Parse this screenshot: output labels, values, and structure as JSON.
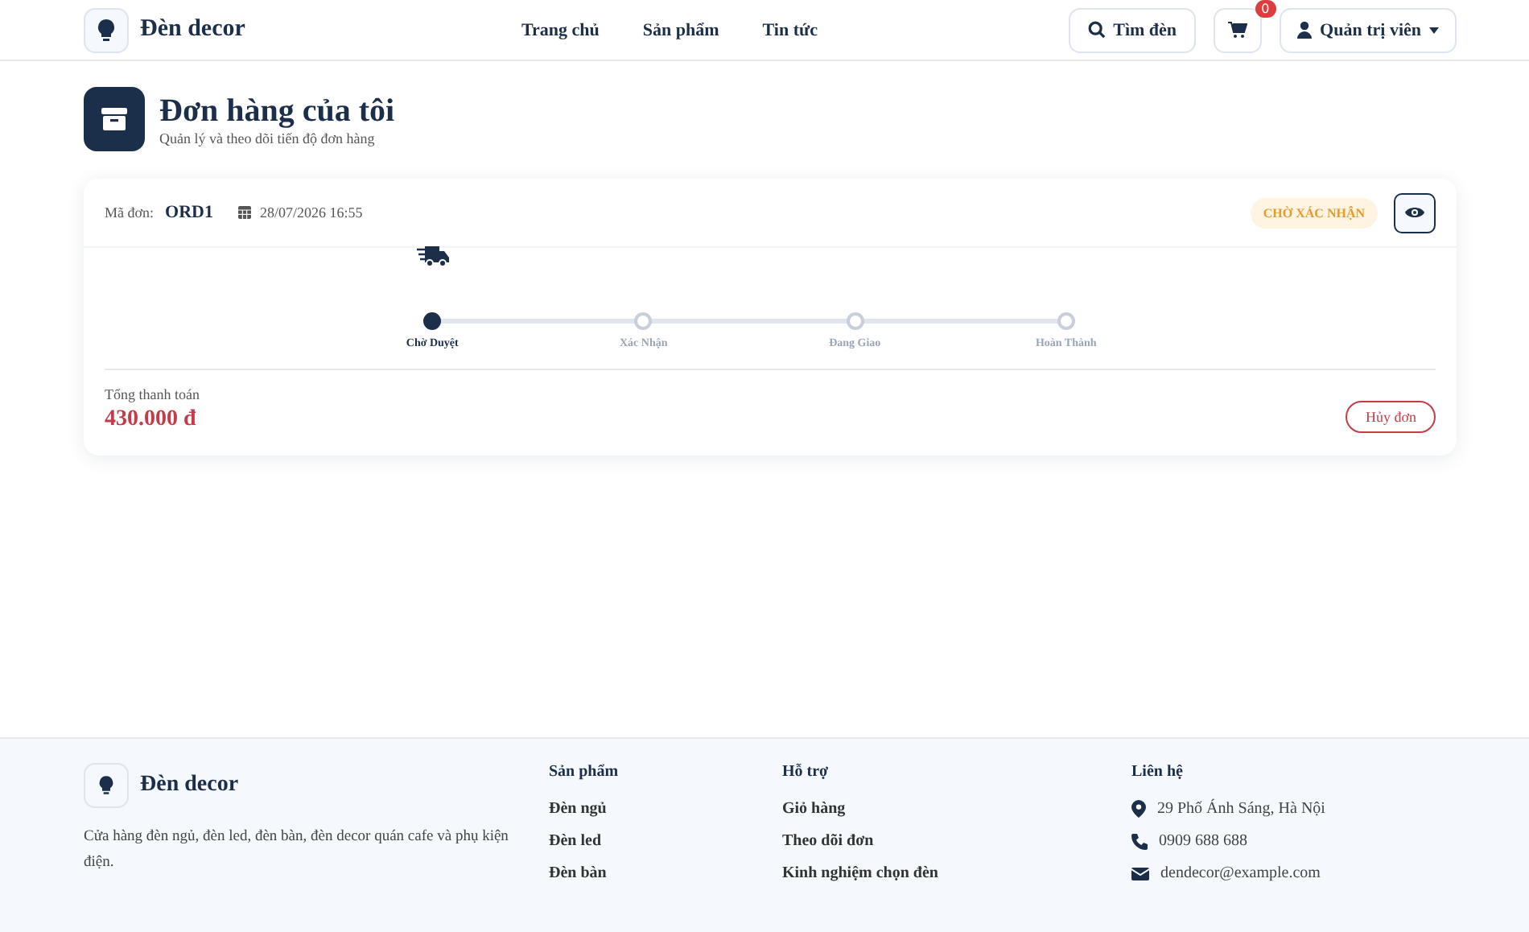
{
  "header": {
    "brand": "Đèn decor",
    "nav": [
      {
        "label": "Trang chủ"
      },
      {
        "label": "Sản phẩm"
      },
      {
        "label": "Tin tức"
      }
    ],
    "search_button": "Tìm đèn",
    "cart_count": "0",
    "user_menu": "Quản trị viên"
  },
  "page": {
    "title": "Đơn hàng của tôi",
    "subtitle": "Quản lý và theo dõi tiến độ đơn hàng"
  },
  "orders": [
    {
      "code_label": "Mã đơn:",
      "code": "ORD1",
      "date": "28/07/2026 16:55",
      "status": "CHỜ XÁC NHẬN",
      "steps": [
        {
          "label": "Chờ Duyệt",
          "selected": true
        },
        {
          "label": "Xác Nhận",
          "selected": false
        },
        {
          "label": "Đang Giao",
          "selected": false
        },
        {
          "label": "Hoàn Thành",
          "selected": false
        }
      ],
      "total_label": "Tổng thanh toán",
      "total": "430.000 đ",
      "cancel_button": "Hủy đơn"
    }
  ],
  "footer": {
    "brand": "Đèn decor",
    "description": "Cửa hàng đèn ngủ, đèn led, đèn bàn, đèn decor quán cafe và phụ kiện điện.",
    "columns": [
      {
        "title": "Sản phẩm",
        "links": [
          "Đèn ngủ",
          "Đèn led",
          "Đèn bàn"
        ]
      },
      {
        "title": "Hỗ trợ",
        "links": [
          "Giỏ hàng",
          "Theo dõi đơn",
          "Kinh nghiệm chọn đèn"
        ]
      }
    ],
    "contact": {
      "title": "Liên hệ",
      "items": [
        {
          "kind": "address",
          "text": "29 Phố Ánh Sáng, Hà Nội"
        },
        {
          "kind": "phone",
          "text": "0909 688 688"
        },
        {
          "kind": "email",
          "text": "dendecor@example.com"
        }
      ]
    }
  }
}
